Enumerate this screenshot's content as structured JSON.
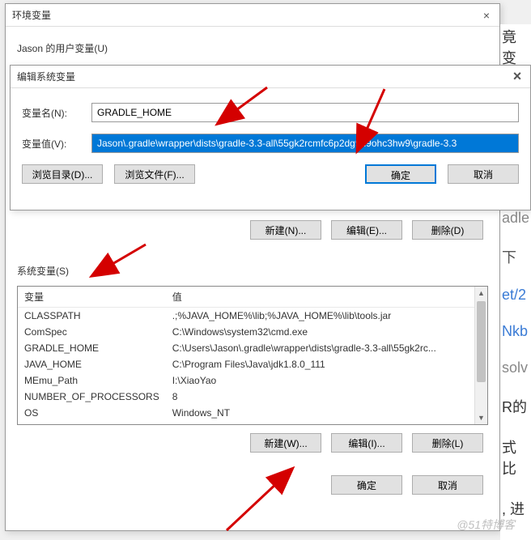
{
  "env_window": {
    "title": "环境变量",
    "user_vars_label": "Jason 的用户变量(U)",
    "sys_vars_label": "系统变量(S)",
    "table_headers": {
      "var": "变量",
      "val": "值"
    },
    "sys_rows": [
      {
        "var": "CLASSPATH",
        "val": ".;%JAVA_HOME%\\lib;%JAVA_HOME%\\lib\\tools.jar"
      },
      {
        "var": "ComSpec",
        "val": "C:\\Windows\\system32\\cmd.exe"
      },
      {
        "var": "GRADLE_HOME",
        "val": "C:\\Users\\Jason\\.gradle\\wrapper\\dists\\gradle-3.3-all\\55gk2rc..."
      },
      {
        "var": "JAVA_HOME",
        "val": "C:\\Program Files\\Java\\jdk1.8.0_111"
      },
      {
        "var": "MEmu_Path",
        "val": "I:\\XiaoYao"
      },
      {
        "var": "NUMBER_OF_PROCESSORS",
        "val": "8"
      },
      {
        "var": "OS",
        "val": "Windows_NT"
      }
    ],
    "buttons": {
      "new_n": "新建(N)...",
      "edit_e": "编辑(E)...",
      "delete_d": "删除(D)",
      "new_w": "新建(W)...",
      "edit_i": "编辑(I)...",
      "delete_l": "删除(L)",
      "ok": "确定",
      "cancel": "取消"
    }
  },
  "edit_window": {
    "title": "编辑系统变量",
    "name_label": "变量名(N):",
    "value_label": "变量值(V):",
    "name_value": "GRADLE_HOME",
    "value_value": "Jason\\.gradle\\wrapper\\dists\\gradle-3.3-all\\55gk2rcmfc6p2dg9u9ohc3hw9\\gradle-3.3",
    "buttons": {
      "browse_dir": "浏览目录(D)...",
      "browse_file": "浏览文件(F)...",
      "ok": "确定",
      "cancel": "取消"
    }
  },
  "right_snips": [
    "竟变",
    "adle",
    "下",
    "et/2",
    "Nkb",
    "solv",
    "R的",
    "式比",
    ", 进"
  ],
  "watermark": "@51特博客"
}
